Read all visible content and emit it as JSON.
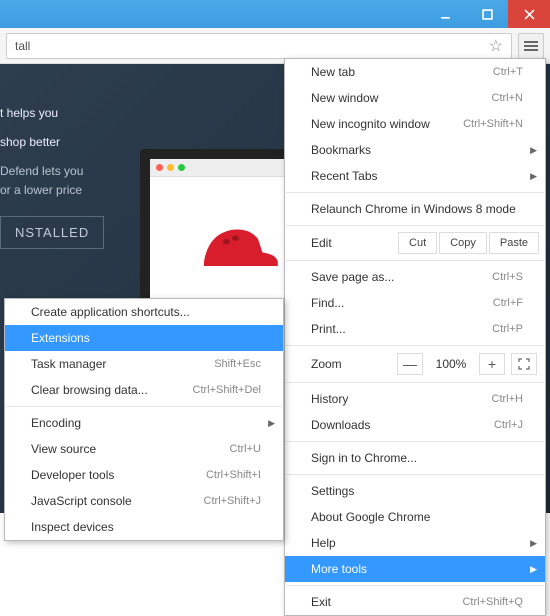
{
  "titlebar": {
    "close": "×"
  },
  "omnibox": {
    "text": "tall"
  },
  "hero": {
    "line1": "t helps you",
    "line2": "shop better",
    "sub1": "Defend lets you",
    "sub2": "or a lower price",
    "installed": "NSTALLED"
  },
  "menu1": {
    "newtab": {
      "label": "New tab",
      "sc": "Ctrl+T"
    },
    "newwin": {
      "label": "New window",
      "sc": "Ctrl+N"
    },
    "incog": {
      "label": "New incognito window",
      "sc": "Ctrl+Shift+N"
    },
    "bookmarks": {
      "label": "Bookmarks"
    },
    "recent": {
      "label": "Recent Tabs"
    },
    "relaunch": {
      "label": "Relaunch Chrome in Windows 8 mode"
    },
    "edit": {
      "label": "Edit",
      "cut": "Cut",
      "copy": "Copy",
      "paste": "Paste"
    },
    "save": {
      "label": "Save page as...",
      "sc": "Ctrl+S"
    },
    "find": {
      "label": "Find...",
      "sc": "Ctrl+F"
    },
    "print": {
      "label": "Print...",
      "sc": "Ctrl+P"
    },
    "zoom": {
      "label": "Zoom",
      "minus": "—",
      "pct": "100%",
      "plus": "+"
    },
    "history": {
      "label": "History",
      "sc": "Ctrl+H"
    },
    "downloads": {
      "label": "Downloads",
      "sc": "Ctrl+J"
    },
    "signin": {
      "label": "Sign in to Chrome..."
    },
    "settings": {
      "label": "Settings"
    },
    "about": {
      "label": "About Google Chrome"
    },
    "help": {
      "label": "Help"
    },
    "more": {
      "label": "More tools"
    },
    "exit": {
      "label": "Exit",
      "sc": "Ctrl+Shift+Q"
    }
  },
  "menu2": {
    "shortcuts": {
      "label": "Create application shortcuts..."
    },
    "ext": {
      "label": "Extensions"
    },
    "task": {
      "label": "Task manager",
      "sc": "Shift+Esc"
    },
    "clear": {
      "label": "Clear browsing data...",
      "sc": "Ctrl+Shift+Del"
    },
    "encoding": {
      "label": "Encoding"
    },
    "source": {
      "label": "View source",
      "sc": "Ctrl+U"
    },
    "devtools": {
      "label": "Developer tools",
      "sc": "Ctrl+Shift+I"
    },
    "jsconsole": {
      "label": "JavaScript console",
      "sc": "Ctrl+Shift+J"
    },
    "inspect": {
      "label": "Inspect devices"
    }
  }
}
